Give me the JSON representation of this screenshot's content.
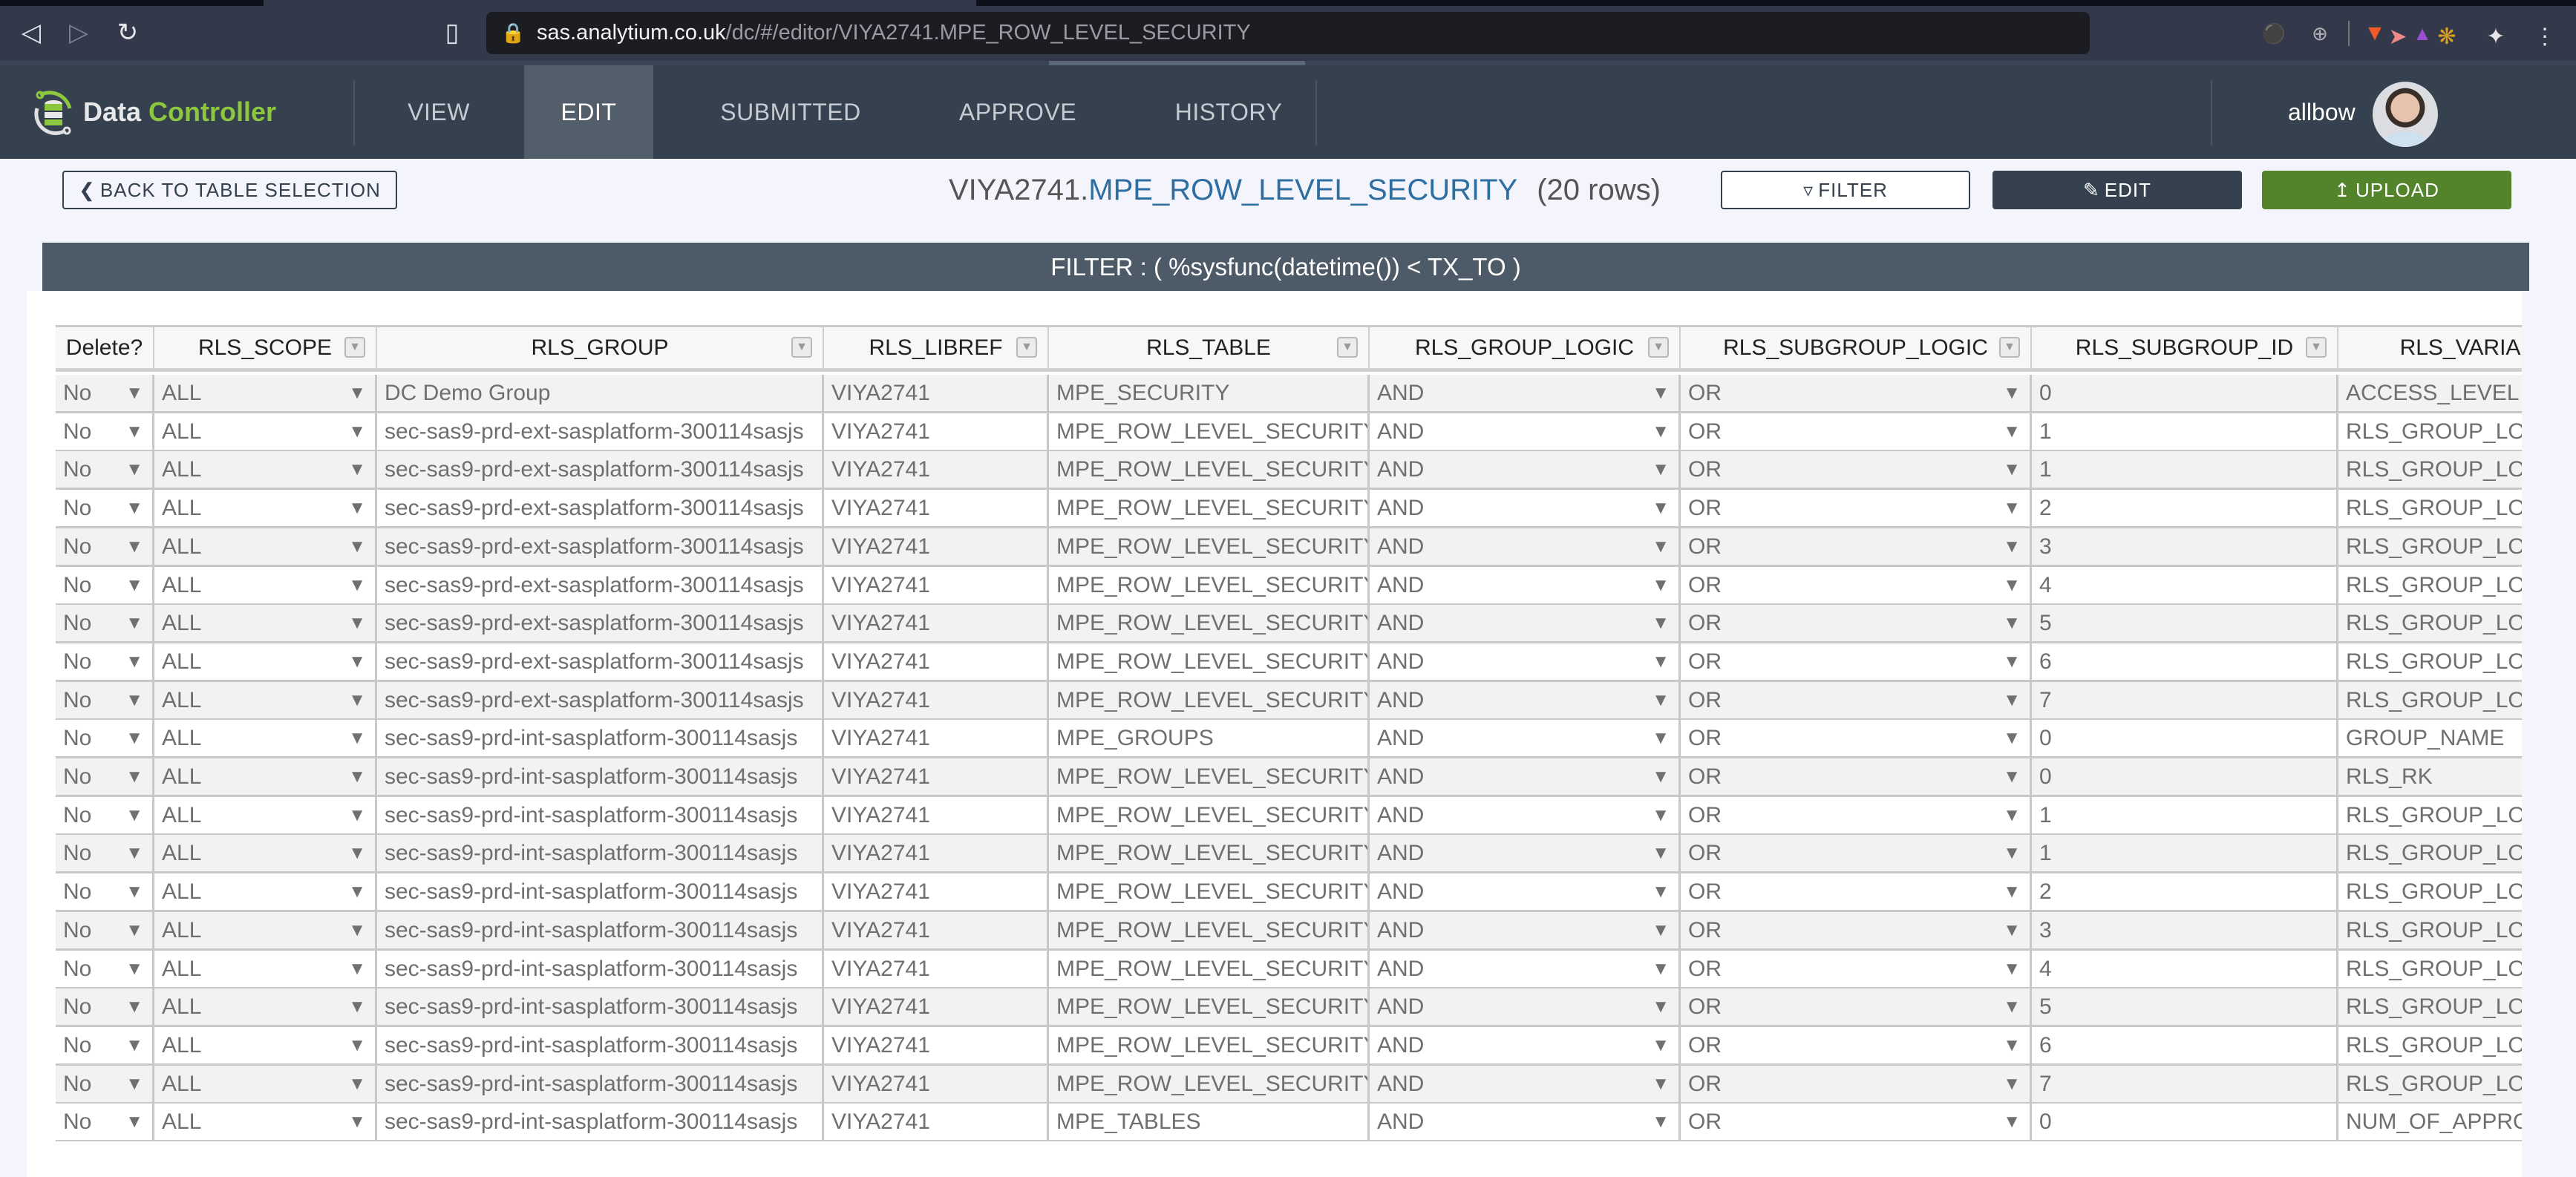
{
  "browser": {
    "url_host": "sas.analytium.co.uk",
    "url_path": "/dc/#/editor/VIYA2741.MPE_ROW_LEVEL_SECURITY",
    "icons": [
      "back-icon",
      "forward-icon",
      "reload-icon",
      "bookmark-icon",
      "lock-icon",
      "key-icon",
      "zoom-icon",
      "brave-shields-icon",
      "brave-rewards-icon",
      "extension-arrow-icon",
      "extension-badge-icon",
      "extensions-puzzle-icon",
      "menu-icon"
    ]
  },
  "app": {
    "logo_word1": "Data",
    "logo_word2": "Controller",
    "nav": [
      {
        "label": "VIEW",
        "active": false
      },
      {
        "label": "EDIT",
        "active": true
      },
      {
        "label": "SUBMITTED",
        "active": false
      },
      {
        "label": "APPROVE",
        "active": false
      },
      {
        "label": "HISTORY",
        "active": false
      }
    ],
    "username": "allbow",
    "colors": {
      "header": "#35414e",
      "accent_green": "#8dc63f",
      "upload_green": "#53832a",
      "table_link": "#2e6ea0"
    }
  },
  "toolbar": {
    "back_label": "BACK TO TABLE SELECTION",
    "title_lib": "VIYA2741.",
    "title_table": "MPE_ROW_LEVEL_SECURITY",
    "title_rows": "(20 rows)",
    "filter_label": "FILTER",
    "edit_label": "EDIT",
    "upload_label": "UPLOAD"
  },
  "filter_banner": "FILTER : ( %sysfunc(datetime()) < TX_TO )",
  "table": {
    "columns": [
      {
        "label": "Delete?",
        "filter": false
      },
      {
        "label": "RLS_SCOPE",
        "filter": true
      },
      {
        "label": "RLS_GROUP",
        "filter": true
      },
      {
        "label": "RLS_LIBREF",
        "filter": true
      },
      {
        "label": "RLS_TABLE",
        "filter": true
      },
      {
        "label": "RLS_GROUP_LOGIC",
        "filter": true
      },
      {
        "label": "RLS_SUBGROUP_LOGIC",
        "filter": true
      },
      {
        "label": "RLS_SUBGROUP_ID",
        "filter": true
      },
      {
        "label": "RLS_VARIA",
        "filter": false
      }
    ],
    "rows": [
      [
        "No",
        "ALL",
        "DC Demo Group",
        "VIYA2741",
        "MPE_SECURITY",
        "AND",
        "OR",
        "0",
        "ACCESS_LEVEL"
      ],
      [
        "No",
        "ALL",
        "sec-sas9-prd-ext-sasplatform-300114sasjs",
        "VIYA2741",
        "MPE_ROW_LEVEL_SECURITY",
        "AND",
        "OR",
        "1",
        "RLS_GROUP_LOG"
      ],
      [
        "No",
        "ALL",
        "sec-sas9-prd-ext-sasplatform-300114sasjs",
        "VIYA2741",
        "MPE_ROW_LEVEL_SECURITY",
        "AND",
        "OR",
        "1",
        "RLS_GROUP_LOG"
      ],
      [
        "No",
        "ALL",
        "sec-sas9-prd-ext-sasplatform-300114sasjs",
        "VIYA2741",
        "MPE_ROW_LEVEL_SECURITY",
        "AND",
        "OR",
        "2",
        "RLS_GROUP_LOG"
      ],
      [
        "No",
        "ALL",
        "sec-sas9-prd-ext-sasplatform-300114sasjs",
        "VIYA2741",
        "MPE_ROW_LEVEL_SECURITY",
        "AND",
        "OR",
        "3",
        "RLS_GROUP_LOG"
      ],
      [
        "No",
        "ALL",
        "sec-sas9-prd-ext-sasplatform-300114sasjs",
        "VIYA2741",
        "MPE_ROW_LEVEL_SECURITY",
        "AND",
        "OR",
        "4",
        "RLS_GROUP_LOG"
      ],
      [
        "No",
        "ALL",
        "sec-sas9-prd-ext-sasplatform-300114sasjs",
        "VIYA2741",
        "MPE_ROW_LEVEL_SECURITY",
        "AND",
        "OR",
        "5",
        "RLS_GROUP_LOG"
      ],
      [
        "No",
        "ALL",
        "sec-sas9-prd-ext-sasplatform-300114sasjs",
        "VIYA2741",
        "MPE_ROW_LEVEL_SECURITY",
        "AND",
        "OR",
        "6",
        "RLS_GROUP_LOG"
      ],
      [
        "No",
        "ALL",
        "sec-sas9-prd-ext-sasplatform-300114sasjs",
        "VIYA2741",
        "MPE_ROW_LEVEL_SECURITY",
        "AND",
        "OR",
        "7",
        "RLS_GROUP_LOG"
      ],
      [
        "No",
        "ALL",
        "sec-sas9-prd-int-sasplatform-300114sasjs",
        "VIYA2741",
        "MPE_GROUPS",
        "AND",
        "OR",
        "0",
        "GROUP_NAME"
      ],
      [
        "No",
        "ALL",
        "sec-sas9-prd-int-sasplatform-300114sasjs",
        "VIYA2741",
        "MPE_ROW_LEVEL_SECURITY",
        "AND",
        "OR",
        "0",
        "RLS_RK"
      ],
      [
        "No",
        "ALL",
        "sec-sas9-prd-int-sasplatform-300114sasjs",
        "VIYA2741",
        "MPE_ROW_LEVEL_SECURITY",
        "AND",
        "OR",
        "1",
        "RLS_GROUP_LOG"
      ],
      [
        "No",
        "ALL",
        "sec-sas9-prd-int-sasplatform-300114sasjs",
        "VIYA2741",
        "MPE_ROW_LEVEL_SECURITY",
        "AND",
        "OR",
        "1",
        "RLS_GROUP_LOG"
      ],
      [
        "No",
        "ALL",
        "sec-sas9-prd-int-sasplatform-300114sasjs",
        "VIYA2741",
        "MPE_ROW_LEVEL_SECURITY",
        "AND",
        "OR",
        "2",
        "RLS_GROUP_LOG"
      ],
      [
        "No",
        "ALL",
        "sec-sas9-prd-int-sasplatform-300114sasjs",
        "VIYA2741",
        "MPE_ROW_LEVEL_SECURITY",
        "AND",
        "OR",
        "3",
        "RLS_GROUP_LOG"
      ],
      [
        "No",
        "ALL",
        "sec-sas9-prd-int-sasplatform-300114sasjs",
        "VIYA2741",
        "MPE_ROW_LEVEL_SECURITY",
        "AND",
        "OR",
        "4",
        "RLS_GROUP_LOG"
      ],
      [
        "No",
        "ALL",
        "sec-sas9-prd-int-sasplatform-300114sasjs",
        "VIYA2741",
        "MPE_ROW_LEVEL_SECURITY",
        "AND",
        "OR",
        "5",
        "RLS_GROUP_LOG"
      ],
      [
        "No",
        "ALL",
        "sec-sas9-prd-int-sasplatform-300114sasjs",
        "VIYA2741",
        "MPE_ROW_LEVEL_SECURITY",
        "AND",
        "OR",
        "6",
        "RLS_GROUP_LOG"
      ],
      [
        "No",
        "ALL",
        "sec-sas9-prd-int-sasplatform-300114sasjs",
        "VIYA2741",
        "MPE_ROW_LEVEL_SECURITY",
        "AND",
        "OR",
        "7",
        "RLS_GROUP_LOG"
      ],
      [
        "No",
        "ALL",
        "sec-sas9-prd-int-sasplatform-300114sasjs",
        "VIYA2741",
        "MPE_TABLES",
        "AND",
        "OR",
        "0",
        "NUM_OF_APPRO"
      ]
    ],
    "dropdown_columns": [
      0,
      1,
      5,
      6
    ]
  }
}
